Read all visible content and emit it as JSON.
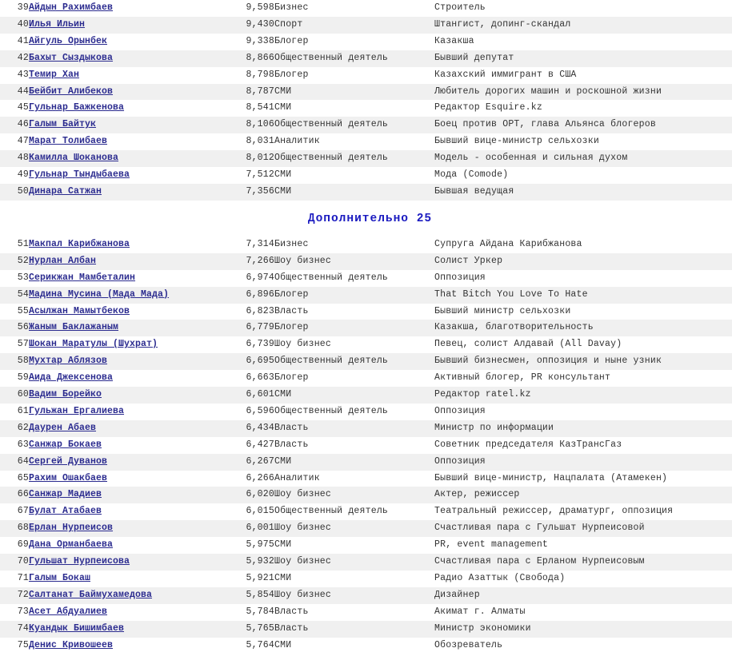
{
  "sections": [
    {
      "id": "top-continued",
      "heading": null,
      "rows": [
        {
          "rank": "39",
          "name": "Айдын Рахимбаев",
          "score": "9,598",
          "category": "Бизнес",
          "description": "Строитель"
        },
        {
          "rank": "40",
          "name": "Илья Ильин",
          "score": "9,430",
          "category": "Спорт",
          "description": "Штангист, допинг-скандал"
        },
        {
          "rank": "41",
          "name": "Айгуль Орынбек",
          "score": "9,338",
          "category": "Блогер",
          "description": "Казакша"
        },
        {
          "rank": "42",
          "name": "Бахыт Сыздыкова",
          "score": "8,866",
          "category": "Общественный деятель",
          "description": "Бывший депутат"
        },
        {
          "rank": "43",
          "name": "Темир Хан",
          "score": "8,798",
          "category": "Блогер",
          "description": "Казахский иммигрант в США"
        },
        {
          "rank": "44",
          "name": "Бейбит Алибеков",
          "score": "8,787",
          "category": "СМИ",
          "description": "Любитель дорогих машин и роскошной жизни"
        },
        {
          "rank": "45",
          "name": "Гульнар Бажкенова",
          "score": "8,541",
          "category": "СМИ",
          "description": "Редактор Esquire.kz"
        },
        {
          "rank": "46",
          "name": "Галым Байтук",
          "score": "8,106",
          "category": "Общественный деятель",
          "description": "Боец против ОРТ, глава Альянса блогеров"
        },
        {
          "rank": "47",
          "name": "Марат Толибаев",
          "score": "8,031",
          "category": "Аналитик",
          "description": "Бывший вице-министр сельхозки"
        },
        {
          "rank": "48",
          "name": "Камилла Шоканова",
          "score": "8,012",
          "category": "Общественный деятель",
          "description": "Модель - особенная и сильная духом"
        },
        {
          "rank": "49",
          "name": "Гульнар Тындыбаева",
          "score": "7,512",
          "category": "СМИ",
          "description": "Мода (Comode)"
        },
        {
          "rank": "50",
          "name": "Динара Сатжан",
          "score": "7,356",
          "category": "СМИ",
          "description": "Бывшая ведущая"
        }
      ]
    },
    {
      "id": "additional-25",
      "heading": "Дополнительно 25",
      "rows": [
        {
          "rank": "51",
          "name": "Макпал Карибжанова",
          "score": "7,314",
          "category": "Бизнес",
          "description": "Супруга Айдана Карибжанова"
        },
        {
          "rank": "52",
          "name": "Нурлан Албан",
          "score": "7,266",
          "category": "Шоу бизнес",
          "description": "Солист Уркер"
        },
        {
          "rank": "53",
          "name": "Серикжан Мамбеталин",
          "score": "6,974",
          "category": "Общественный деятель",
          "description": "Оппозиция"
        },
        {
          "rank": "54",
          "name": "Мадина Мусина (Мада Мада)",
          "score": "6,896",
          "category": "Блогер",
          "description": "That Bitch You Love To Hate"
        },
        {
          "rank": "55",
          "name": "Асылжан Мамытбеков",
          "score": "6,823",
          "category": "Власть",
          "description": "Бывший министр сельхозки"
        },
        {
          "rank": "56",
          "name": "Жаным Баклажаным",
          "score": "6,779",
          "category": "Блогер",
          "description": "Казакша, благотворительность"
        },
        {
          "rank": "57",
          "name": "Шокан Маратулы (Шухрат)",
          "score": "6,739",
          "category": "Шоу бизнес",
          "description": "Певец, солист Алдавай (All Davay)"
        },
        {
          "rank": "58",
          "name": "Мухтар Аблязов",
          "score": "6,695",
          "category": "Общественный деятель",
          "description": "Бывший бизнесмен, оппозиция и ныне узник"
        },
        {
          "rank": "59",
          "name": "Аида Джексенова",
          "score": "6,663",
          "category": "Блогер",
          "description": "Активный блогер, PR консультант"
        },
        {
          "rank": "60",
          "name": "Вадим Борейко",
          "score": "6,601",
          "category": "СМИ",
          "description": "Редактор ratel.kz"
        },
        {
          "rank": "61",
          "name": "Гульжан Ергалиева",
          "score": "6,596",
          "category": "Общественный деятель",
          "description": "Оппозиция"
        },
        {
          "rank": "62",
          "name": "Даурен Абаев",
          "score": "6,434",
          "category": "Власть",
          "description": "Министр по информации"
        },
        {
          "rank": "63",
          "name": "Санжар Бокаев",
          "score": "6,427",
          "category": "Власть",
          "description": "Советник председателя КазТрансГаз"
        },
        {
          "rank": "64",
          "name": "Сергей Дуванов",
          "score": "6,267",
          "category": "СМИ",
          "description": "Оппозиция"
        },
        {
          "rank": "65",
          "name": "Рахим Ошакбаев",
          "score": "6,266",
          "category": "Аналитик",
          "description": "Бывший вице-министр, Нацпалата (Атамекен)"
        },
        {
          "rank": "66",
          "name": "Санжар Мадиев",
          "score": "6,020",
          "category": "Шоу бизнес",
          "description": "Актер, режиссер"
        },
        {
          "rank": "67",
          "name": "Булат Атабаев",
          "score": "6,015",
          "category": "Общественный деятель",
          "description": "Театральный режиссер, драматург, оппозиция"
        },
        {
          "rank": "68",
          "name": "Ерлан Нурпеисов",
          "score": "6,001",
          "category": "Шоу бизнес",
          "description": "Счастливая пара с Гульшат Нурпеисовой"
        },
        {
          "rank": "69",
          "name": "Дана Орманбаева",
          "score": "5,975",
          "category": "СМИ",
          "description": "PR, event management"
        },
        {
          "rank": "70",
          "name": "Гульшат Нурпеисова",
          "score": "5,932",
          "category": "Шоу бизнес",
          "description": "Счастливая пара с Ерланом Нурпеисовым"
        },
        {
          "rank": "71",
          "name": "Галым Бокаш",
          "score": "5,921",
          "category": "СМИ",
          "description": "Радио Азаттык (Свобода)"
        },
        {
          "rank": "72",
          "name": "Салтанат Баймухамедова",
          "score": "5,854",
          "category": "Шоу бизнес",
          "description": "Дизайнер"
        },
        {
          "rank": "73",
          "name": "Асет Абдуалиев",
          "score": "5,784",
          "category": "Власть",
          "description": "Акимат г. Алматы"
        },
        {
          "rank": "74",
          "name": "Куандык Бишимбаев",
          "score": "5,765",
          "category": "Власть",
          "description": "Министр экономики"
        },
        {
          "rank": "75",
          "name": "Денис Кривошеев",
          "score": "5,764",
          "category": "СМИ",
          "description": "Обозреватель"
        }
      ]
    }
  ],
  "colors": {
    "link": "#2b2b8f",
    "heading": "#1b1bc0",
    "row_stripe": "#f0f0f0",
    "row_base": "#ffffff",
    "text": "#333333"
  }
}
